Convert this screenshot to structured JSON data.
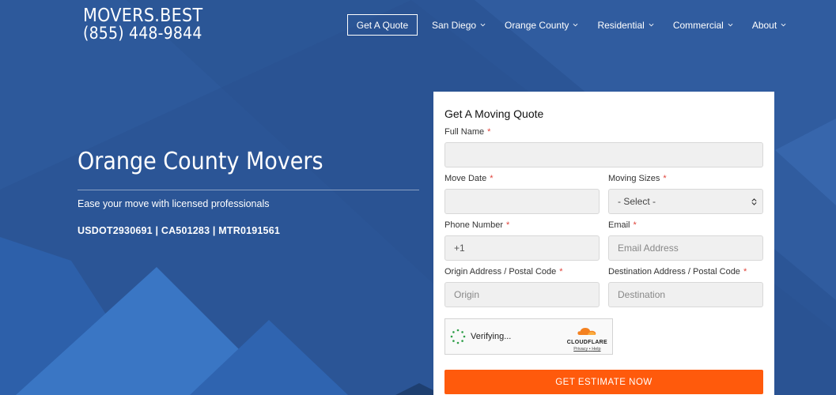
{
  "header": {
    "brand": "MOVERS.BEST",
    "phone": "(855) 448-9844",
    "nav": {
      "quote_button": "Get A Quote",
      "items": [
        {
          "label": "San Diego"
        },
        {
          "label": "Orange County"
        },
        {
          "label": "Residential"
        },
        {
          "label": "Commercial"
        },
        {
          "label": "About"
        }
      ]
    }
  },
  "hero": {
    "title": "Orange County Movers",
    "tagline": "Ease your move with licensed professionals",
    "license": "USDOT2930691 | CA501283 | MTR0191561"
  },
  "form": {
    "title": "Get A Moving Quote",
    "required_mark": "*",
    "full_name": {
      "label": "Full Name",
      "value": "",
      "placeholder": ""
    },
    "move_date": {
      "label": "Move Date",
      "value": "",
      "placeholder": ""
    },
    "moving_sizes": {
      "label": "Moving Sizes",
      "selected": "- Select -"
    },
    "phone": {
      "label": "Phone Number",
      "value": "+1"
    },
    "email": {
      "label": "Email",
      "placeholder": "Email Address"
    },
    "origin": {
      "label": "Origin Address / Postal Code",
      "placeholder": "Origin"
    },
    "destination": {
      "label": "Destination Address / Postal Code",
      "placeholder": "Destination"
    },
    "captcha": {
      "status": "Verifying...",
      "provider": "CLOUDFLARE",
      "privacy": "Privacy",
      "separator": "•",
      "help": "Help"
    },
    "submit_label": "GET ESTIMATE NOW"
  },
  "colors": {
    "background": "#2a5494",
    "accent": "#ff5a0c",
    "required": "#e0433a"
  }
}
